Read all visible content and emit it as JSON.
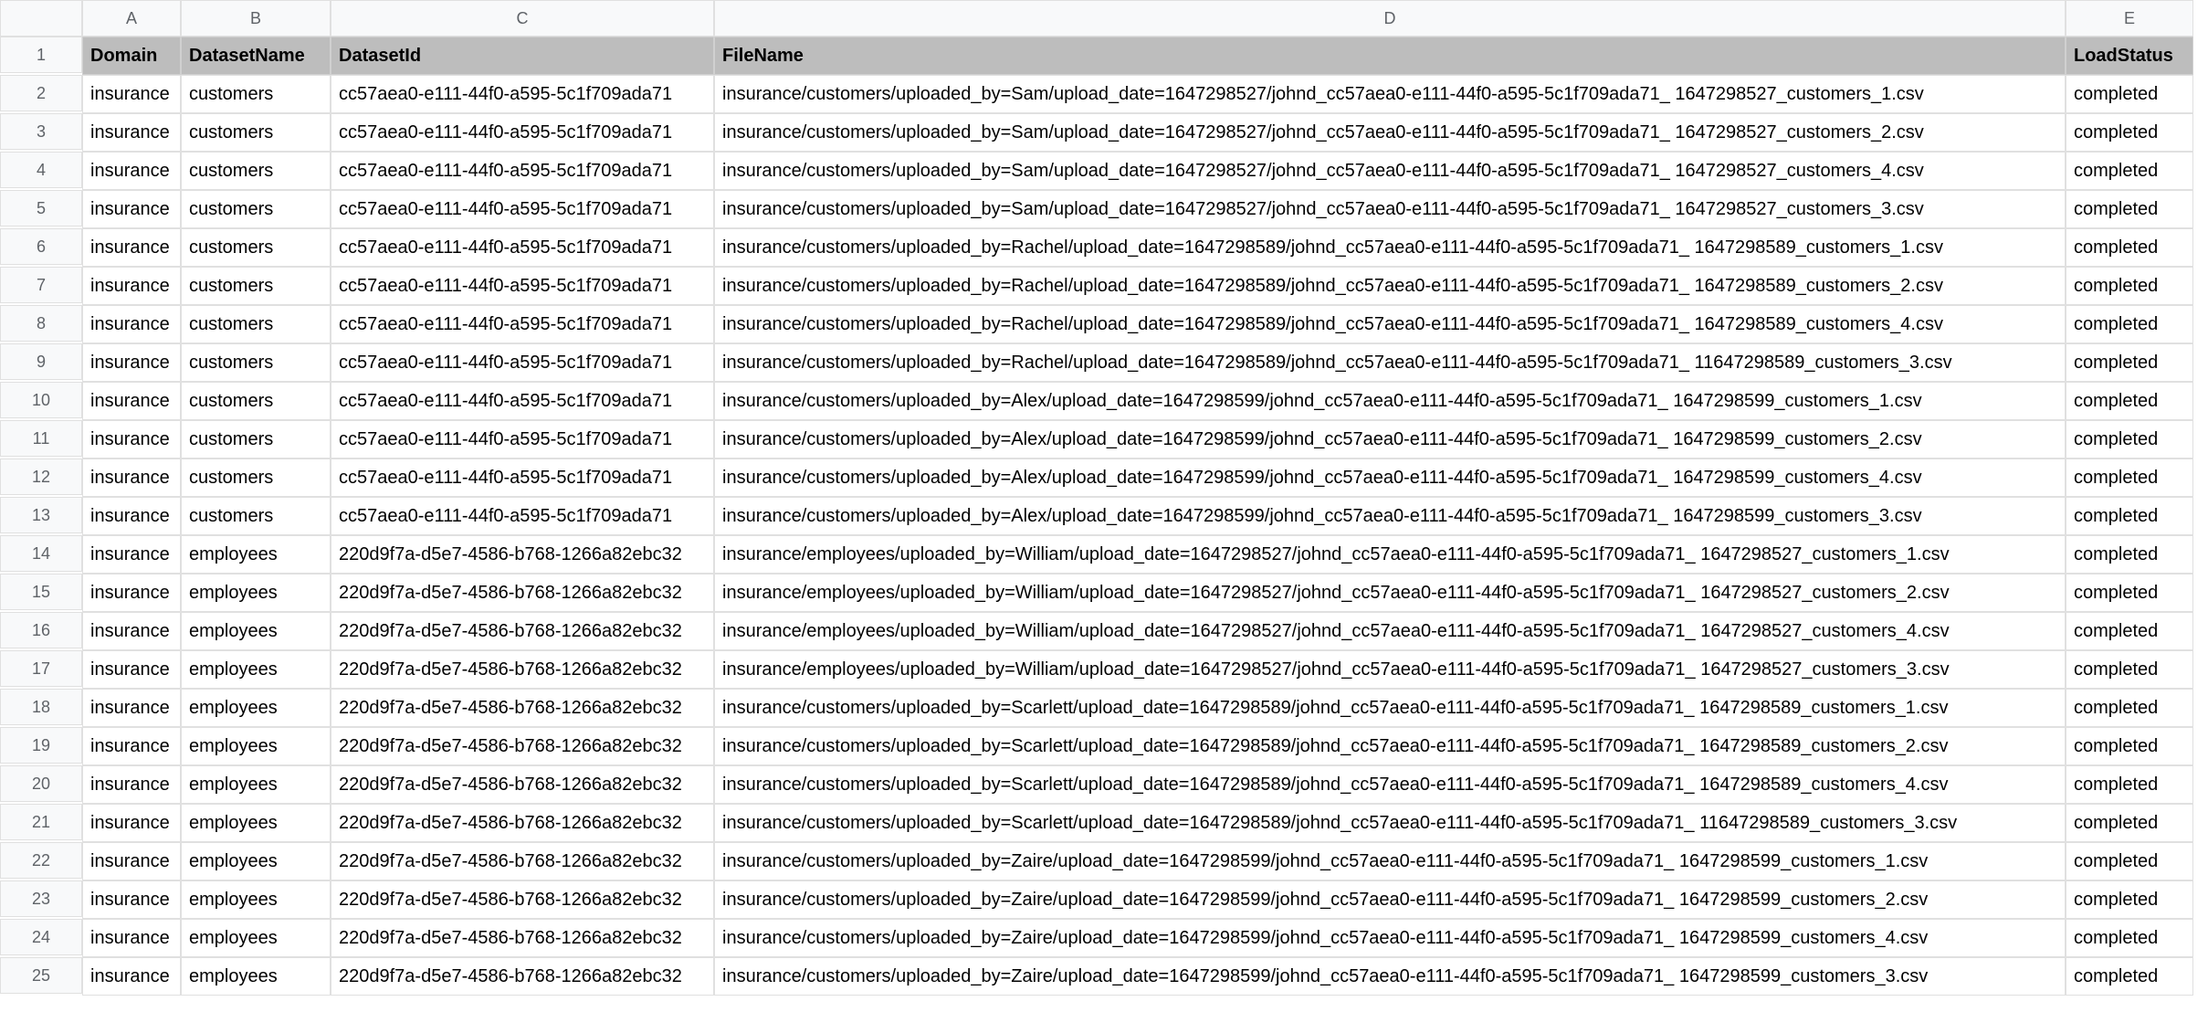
{
  "columns": [
    "A",
    "B",
    "C",
    "D",
    "E"
  ],
  "headers": {
    "A": "Domain",
    "B": "DatasetName",
    "C": "DatasetId",
    "D": "FileName",
    "E": "LoadStatus"
  },
  "rows": [
    {
      "n": "1"
    },
    {
      "n": "2",
      "A": "insurance",
      "B": "customers",
      "C": "cc57aea0-e111-44f0-a595-5c1f709ada71",
      "D": "insurance/customers/uploaded_by=Sam/upload_date=1647298527/johnd_cc57aea0-e111-44f0-a595-5c1f709ada71_ 1647298527_customers_1.csv",
      "E": "completed"
    },
    {
      "n": "3",
      "A": "insurance",
      "B": "customers",
      "C": "cc57aea0-e111-44f0-a595-5c1f709ada71",
      "D": "insurance/customers/uploaded_by=Sam/upload_date=1647298527/johnd_cc57aea0-e111-44f0-a595-5c1f709ada71_ 1647298527_customers_2.csv",
      "E": "completed"
    },
    {
      "n": "4",
      "A": "insurance",
      "B": "customers",
      "C": "cc57aea0-e111-44f0-a595-5c1f709ada71",
      "D": "insurance/customers/uploaded_by=Sam/upload_date=1647298527/johnd_cc57aea0-e111-44f0-a595-5c1f709ada71_ 1647298527_customers_4.csv",
      "E": "completed"
    },
    {
      "n": "5",
      "A": "insurance",
      "B": "customers",
      "C": "cc57aea0-e111-44f0-a595-5c1f709ada71",
      "D": "insurance/customers/uploaded_by=Sam/upload_date=1647298527/johnd_cc57aea0-e111-44f0-a595-5c1f709ada71_ 1647298527_customers_3.csv",
      "E": "completed"
    },
    {
      "n": "6",
      "A": "insurance",
      "B": "customers",
      "C": "cc57aea0-e111-44f0-a595-5c1f709ada71",
      "D": "insurance/customers/uploaded_by=Rachel/upload_date=1647298589/johnd_cc57aea0-e111-44f0-a595-5c1f709ada71_ 1647298589_customers_1.csv",
      "E": "completed"
    },
    {
      "n": "7",
      "A": "insurance",
      "B": "customers",
      "C": "cc57aea0-e111-44f0-a595-5c1f709ada71",
      "D": "insurance/customers/uploaded_by=Rachel/upload_date=1647298589/johnd_cc57aea0-e111-44f0-a595-5c1f709ada71_ 1647298589_customers_2.csv",
      "E": "completed"
    },
    {
      "n": "8",
      "A": "insurance",
      "B": "customers",
      "C": "cc57aea0-e111-44f0-a595-5c1f709ada71",
      "D": "insurance/customers/uploaded_by=Rachel/upload_date=1647298589/johnd_cc57aea0-e111-44f0-a595-5c1f709ada71_ 1647298589_customers_4.csv",
      "E": "completed"
    },
    {
      "n": "9",
      "A": "insurance",
      "B": "customers",
      "C": "cc57aea0-e111-44f0-a595-5c1f709ada71",
      "D": "insurance/customers/uploaded_by=Rachel/upload_date=1647298589/johnd_cc57aea0-e111-44f0-a595-5c1f709ada71_ 11647298589_customers_3.csv",
      "E": "completed"
    },
    {
      "n": "10",
      "A": "insurance",
      "B": "customers",
      "C": "cc57aea0-e111-44f0-a595-5c1f709ada71",
      "D": "insurance/customers/uploaded_by=Alex/upload_date=1647298599/johnd_cc57aea0-e111-44f0-a595-5c1f709ada71_ 1647298599_customers_1.csv",
      "E": "completed"
    },
    {
      "n": "11",
      "A": "insurance",
      "B": "customers",
      "C": "cc57aea0-e111-44f0-a595-5c1f709ada71",
      "D": "insurance/customers/uploaded_by=Alex/upload_date=1647298599/johnd_cc57aea0-e111-44f0-a595-5c1f709ada71_ 1647298599_customers_2.csv",
      "E": "completed"
    },
    {
      "n": "12",
      "A": "insurance",
      "B": "customers",
      "C": "cc57aea0-e111-44f0-a595-5c1f709ada71",
      "D": "insurance/customers/uploaded_by=Alex/upload_date=1647298599/johnd_cc57aea0-e111-44f0-a595-5c1f709ada71_ 1647298599_customers_4.csv",
      "E": "completed"
    },
    {
      "n": "13",
      "A": "insurance",
      "B": "customers",
      "C": "cc57aea0-e111-44f0-a595-5c1f709ada71",
      "D": "insurance/customers/uploaded_by=Alex/upload_date=1647298599/johnd_cc57aea0-e111-44f0-a595-5c1f709ada71_ 1647298599_customers_3.csv",
      "E": "completed"
    },
    {
      "n": "14",
      "A": "insurance",
      "B": "employees",
      "C": "220d9f7a-d5e7-4586-b768-1266a82ebc32",
      "D": "insurance/employees/uploaded_by=William/upload_date=1647298527/johnd_cc57aea0-e111-44f0-a595-5c1f709ada71_ 1647298527_customers_1.csv",
      "E": "completed"
    },
    {
      "n": "15",
      "A": "insurance",
      "B": "employees",
      "C": "220d9f7a-d5e7-4586-b768-1266a82ebc32",
      "D": "insurance/employees/uploaded_by=William/upload_date=1647298527/johnd_cc57aea0-e111-44f0-a595-5c1f709ada71_ 1647298527_customers_2.csv",
      "E": "completed"
    },
    {
      "n": "16",
      "A": "insurance",
      "B": "employees",
      "C": "220d9f7a-d5e7-4586-b768-1266a82ebc32",
      "D": "insurance/employees/uploaded_by=William/upload_date=1647298527/johnd_cc57aea0-e111-44f0-a595-5c1f709ada71_ 1647298527_customers_4.csv",
      "E": "completed"
    },
    {
      "n": "17",
      "A": "insurance",
      "B": "employees",
      "C": "220d9f7a-d5e7-4586-b768-1266a82ebc32",
      "D": "insurance/employees/uploaded_by=William/upload_date=1647298527/johnd_cc57aea0-e111-44f0-a595-5c1f709ada71_ 1647298527_customers_3.csv",
      "E": "completed"
    },
    {
      "n": "18",
      "A": "insurance",
      "B": "employees",
      "C": "220d9f7a-d5e7-4586-b768-1266a82ebc32",
      "D": "insurance/customers/uploaded_by=Scarlett/upload_date=1647298589/johnd_cc57aea0-e111-44f0-a595-5c1f709ada71_ 1647298589_customers_1.csv",
      "E": "completed"
    },
    {
      "n": "19",
      "A": "insurance",
      "B": "employees",
      "C": "220d9f7a-d5e7-4586-b768-1266a82ebc32",
      "D": "insurance/customers/uploaded_by=Scarlett/upload_date=1647298589/johnd_cc57aea0-e111-44f0-a595-5c1f709ada71_ 1647298589_customers_2.csv",
      "E": "completed"
    },
    {
      "n": "20",
      "A": "insurance",
      "B": "employees",
      "C": "220d9f7a-d5e7-4586-b768-1266a82ebc32",
      "D": "insurance/customers/uploaded_by=Scarlett/upload_date=1647298589/johnd_cc57aea0-e111-44f0-a595-5c1f709ada71_ 1647298589_customers_4.csv",
      "E": "completed"
    },
    {
      "n": "21",
      "A": "insurance",
      "B": "employees",
      "C": "220d9f7a-d5e7-4586-b768-1266a82ebc32",
      "D": "insurance/customers/uploaded_by=Scarlett/upload_date=1647298589/johnd_cc57aea0-e111-44f0-a595-5c1f709ada71_ 11647298589_customers_3.csv",
      "E": "completed"
    },
    {
      "n": "22",
      "A": "insurance",
      "B": "employees",
      "C": "220d9f7a-d5e7-4586-b768-1266a82ebc32",
      "D": "insurance/customers/uploaded_by=Zaire/upload_date=1647298599/johnd_cc57aea0-e111-44f0-a595-5c1f709ada71_ 1647298599_customers_1.csv",
      "E": "completed"
    },
    {
      "n": "23",
      "A": "insurance",
      "B": "employees",
      "C": "220d9f7a-d5e7-4586-b768-1266a82ebc32",
      "D": "insurance/customers/uploaded_by=Zaire/upload_date=1647298599/johnd_cc57aea0-e111-44f0-a595-5c1f709ada71_ 1647298599_customers_2.csv",
      "E": "completed"
    },
    {
      "n": "24",
      "A": "insurance",
      "B": "employees",
      "C": "220d9f7a-d5e7-4586-b768-1266a82ebc32",
      "D": "insurance/customers/uploaded_by=Zaire/upload_date=1647298599/johnd_cc57aea0-e111-44f0-a595-5c1f709ada71_ 1647298599_customers_4.csv",
      "E": "completed"
    },
    {
      "n": "25",
      "A": "insurance",
      "B": "employees",
      "C": "220d9f7a-d5e7-4586-b768-1266a82ebc32",
      "D": "insurance/customers/uploaded_by=Zaire/upload_date=1647298599/johnd_cc57aea0-e111-44f0-a595-5c1f709ada71_ 1647298599_customers_3.csv",
      "E": "completed"
    }
  ]
}
